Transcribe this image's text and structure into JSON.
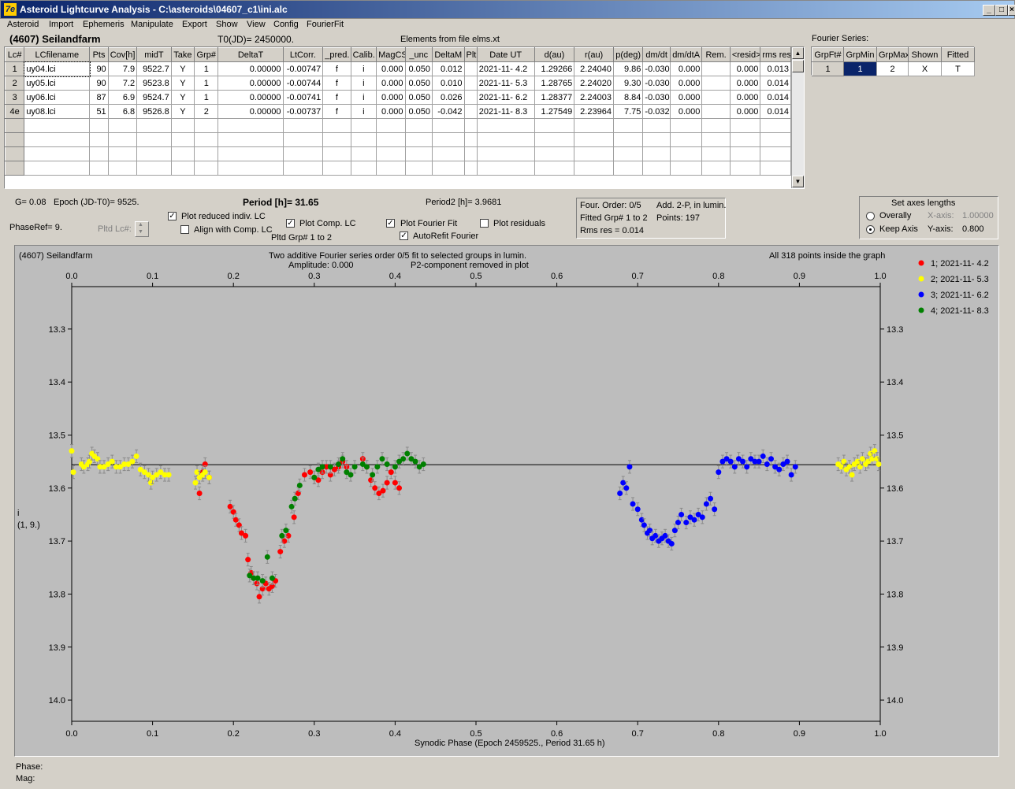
{
  "window": {
    "title": "Asteroid Lightcurve Analysis - C:\\asteroids\\04607_c1\\ini.alc",
    "icon_label": "7e",
    "btn_min": "_",
    "btn_max": "□",
    "btn_close": "×"
  },
  "menu": [
    "Asteroid",
    "Import",
    "Ephemeris",
    "Manipulate",
    "Export",
    "Show",
    "View",
    "Config",
    "FourierFit"
  ],
  "header": {
    "object": "(4607) Seilandfarm",
    "t0": "T0(JD)= 2450000.",
    "elements": "Elements from file elms.xt"
  },
  "lc_table": {
    "columns": [
      "Lc#",
      "LCfilename",
      "Pts",
      "Cov[h]",
      "midT",
      "Take",
      "Grp#",
      "DeltaT",
      "LtCorr.",
      "_pred.",
      "Calib.",
      "MagCS",
      "_unc",
      "DeltaM",
      "Plt",
      "Date UT",
      "d(au)",
      "r(au)",
      "p(deg)",
      "dm/dt",
      "dm/dtA",
      "Rem.",
      "<resid>",
      "rms res"
    ],
    "rows": [
      [
        "1",
        "uy04.lci",
        "90",
        "7.9",
        "9522.7",
        "Y",
        "1",
        "0.00000",
        "-0.00747",
        "f",
        "i",
        "0.000",
        "0.050",
        "0.012",
        "",
        "2021-11- 4.2",
        "1.29266",
        "2.24040",
        "9.86",
        "-0.030",
        "0.000",
        "",
        "0.000",
        "0.013"
      ],
      [
        "2",
        "uy05.lci",
        "90",
        "7.2",
        "9523.8",
        "Y",
        "1",
        "0.00000",
        "-0.00744",
        "f",
        "i",
        "0.000",
        "0.050",
        "0.010",
        "",
        "2021-11- 5.3",
        "1.28765",
        "2.24020",
        "9.30",
        "-0.030",
        "0.000",
        "",
        "0.000",
        "0.014"
      ],
      [
        "3",
        "uy06.lci",
        "87",
        "6.9",
        "9524.7",
        "Y",
        "1",
        "0.00000",
        "-0.00741",
        "f",
        "i",
        "0.000",
        "0.050",
        "0.026",
        "",
        "2021-11- 6.2",
        "1.28377",
        "2.24003",
        "8.84",
        "-0.030",
        "0.000",
        "",
        "0.000",
        "0.014"
      ],
      [
        "4e",
        "uy08.lci",
        "51",
        "6.8",
        "9526.8",
        "Y",
        "2",
        "0.00000",
        "-0.00737",
        "f",
        "i",
        "0.000",
        "0.050",
        "-0.042",
        "",
        "2021-11- 8.3",
        "1.27549",
        "2.23964",
        "7.75",
        "-0.032",
        "0.000",
        "",
        "0.000",
        "0.014"
      ]
    ]
  },
  "fourier_series": {
    "label": "Fourier Series:",
    "columns": [
      "GrpFt#",
      "GrpMin",
      "GrpMax",
      "Shown",
      "Fitted"
    ],
    "row": [
      "1",
      "1",
      "2",
      "X",
      "T"
    ]
  },
  "info": {
    "g": "G= 0.08",
    "epoch": "Epoch (JD-T0)= 9525.",
    "period": "Period [h]= 31.65",
    "period2": "Period2 [h]= 3.9681",
    "phaseref": "PhaseRef= 9.",
    "pltd_lc": "Pltd Lc#:",
    "plot_reduced": "Plot reduced indiv. LC",
    "align_comp": "Align with Comp. LC",
    "plot_comp": "Plot Comp. LC",
    "pltd_grp": "Pltd Grp#  1   to   2",
    "plot_fourier": "Plot Fourier Fit",
    "autorefit": "AutoRefit Fourier",
    "plot_residuals": "Plot residuals",
    "checks": {
      "plot_reduced": "✓",
      "align_comp": "",
      "plot_comp": "✓",
      "plot_fourier": "✓",
      "autorefit": "✓",
      "plot_residuals": ""
    }
  },
  "fit_summary": {
    "order": "Four. Order:  0/5",
    "add": "Add. 2-P, in lumin.",
    "fitted": "Fitted Grp# 1 to 2",
    "points": "Points: 197",
    "rms": "Rms res      = 0.014"
  },
  "axes_lengths": {
    "title": "Set axes lengths",
    "overally": "Overally",
    "keep": "Keep Axis",
    "xaxis_label": "X-axis:",
    "xaxis_val": "1.00000",
    "yaxis_label": "Y-axis:",
    "yaxis_val": "0.800"
  },
  "plot_texts": {
    "object": "(4607) Seilandfarm",
    "subtitle1": "Two additive Fourier series order 0/5 fit to selected groups in lumin.",
    "amplitude": "Amplitude: 0.000",
    "p2": "P2-component removed in plot",
    "points": "All 318 points inside the graph",
    "ylabel1": "i",
    "ylabel2": "(1, 9.)",
    "xlabel": "Synodic Phase (Epoch 2459525., Period 31.65 h)"
  },
  "status": {
    "phase": "Phase:",
    "mag": "Mag:"
  },
  "chart_data": {
    "type": "scatter",
    "xlim": [
      0.0,
      1.0
    ],
    "ylim": [
      13.22,
      14.04
    ],
    "y_inverted": true,
    "x_ticks": [
      "0.0",
      "0.1",
      "0.2",
      "0.3",
      "0.4",
      "0.5",
      "0.6",
      "0.7",
      "0.8",
      "0.9",
      "1.0"
    ],
    "y_ticks": [
      "13.3",
      "13.4",
      "13.5",
      "13.6",
      "13.7",
      "13.8",
      "13.9",
      "14.0"
    ],
    "fit_line_y": 13.556,
    "error_bar": 0.012,
    "series": [
      {
        "name": "1; 2021-11- 4.2",
        "color": "#ff0000",
        "points": [
          [
            0.158,
            13.61
          ],
          [
            0.162,
            13.57
          ],
          [
            0.165,
            13.555
          ],
          [
            0.17,
            13.58
          ],
          [
            0.196,
            13.635
          ],
          [
            0.2,
            13.645
          ],
          [
            0.203,
            13.66
          ],
          [
            0.207,
            13.67
          ],
          [
            0.21,
            13.685
          ],
          [
            0.215,
            13.69
          ],
          [
            0.218,
            13.735
          ],
          [
            0.222,
            13.76
          ],
          [
            0.225,
            13.77
          ],
          [
            0.229,
            13.78
          ],
          [
            0.232,
            13.805
          ],
          [
            0.236,
            13.79
          ],
          [
            0.24,
            13.78
          ],
          [
            0.244,
            13.79
          ],
          [
            0.248,
            13.785
          ],
          [
            0.252,
            13.775
          ],
          [
            0.258,
            13.72
          ],
          [
            0.263,
            13.7
          ],
          [
            0.268,
            13.69
          ],
          [
            0.275,
            13.655
          ],
          [
            0.28,
            13.61
          ],
          [
            0.288,
            13.575
          ],
          [
            0.295,
            13.57
          ],
          [
            0.3,
            13.58
          ],
          [
            0.305,
            13.585
          ],
          [
            0.31,
            13.57
          ],
          [
            0.315,
            13.56
          ],
          [
            0.32,
            13.575
          ],
          [
            0.325,
            13.565
          ],
          [
            0.33,
            13.56
          ],
          [
            0.335,
            13.55
          ],
          [
            0.34,
            13.56
          ],
          [
            0.36,
            13.545
          ],
          [
            0.365,
            13.56
          ],
          [
            0.37,
            13.585
          ],
          [
            0.375,
            13.6
          ],
          [
            0.38,
            13.61
          ],
          [
            0.385,
            13.605
          ],
          [
            0.39,
            13.59
          ],
          [
            0.395,
            13.57
          ],
          [
            0.4,
            13.59
          ],
          [
            0.405,
            13.6
          ]
        ]
      },
      {
        "name": "2; 2021-11- 5.3",
        "color": "#ffff00",
        "points": [
          [
            0.0,
            13.53
          ],
          [
            0.002,
            13.57
          ],
          [
            0.012,
            13.555
          ],
          [
            0.015,
            13.56
          ],
          [
            0.02,
            13.555
          ],
          [
            0.022,
            13.55
          ],
          [
            0.025,
            13.535
          ],
          [
            0.028,
            13.54
          ],
          [
            0.032,
            13.545
          ],
          [
            0.035,
            13.56
          ],
          [
            0.04,
            13.56
          ],
          [
            0.045,
            13.555
          ],
          [
            0.05,
            13.55
          ],
          [
            0.055,
            13.56
          ],
          [
            0.06,
            13.56
          ],
          [
            0.065,
            13.555
          ],
          [
            0.07,
            13.555
          ],
          [
            0.075,
            13.55
          ],
          [
            0.08,
            13.54
          ],
          [
            0.085,
            13.565
          ],
          [
            0.09,
            13.57
          ],
          [
            0.095,
            13.575
          ],
          [
            0.098,
            13.59
          ],
          [
            0.1,
            13.58
          ],
          [
            0.105,
            13.575
          ],
          [
            0.11,
            13.57
          ],
          [
            0.115,
            13.575
          ],
          [
            0.12,
            13.575
          ],
          [
            0.153,
            13.59
          ],
          [
            0.155,
            13.57
          ],
          [
            0.158,
            13.58
          ],
          [
            0.162,
            13.575
          ],
          [
            0.165,
            13.57
          ],
          [
            0.17,
            13.58
          ],
          [
            0.948,
            13.555
          ],
          [
            0.952,
            13.56
          ],
          [
            0.955,
            13.55
          ],
          [
            0.958,
            13.565
          ],
          [
            0.962,
            13.56
          ],
          [
            0.965,
            13.575
          ],
          [
            0.968,
            13.555
          ],
          [
            0.972,
            13.55
          ],
          [
            0.975,
            13.56
          ],
          [
            0.978,
            13.545
          ],
          [
            0.982,
            13.555
          ],
          [
            0.985,
            13.55
          ],
          [
            0.988,
            13.535
          ],
          [
            0.99,
            13.545
          ],
          [
            0.993,
            13.53
          ],
          [
            0.996,
            13.545
          ],
          [
            0.998,
            13.555
          ]
        ]
      },
      {
        "name": "3; 2021-11- 6.2",
        "color": "#0000ff",
        "points": [
          [
            0.678,
            13.61
          ],
          [
            0.682,
            13.59
          ],
          [
            0.686,
            13.6
          ],
          [
            0.69,
            13.56
          ],
          [
            0.694,
            13.63
          ],
          [
            0.7,
            13.64
          ],
          [
            0.705,
            13.66
          ],
          [
            0.708,
            13.67
          ],
          [
            0.712,
            13.685
          ],
          [
            0.715,
            13.68
          ],
          [
            0.718,
            13.695
          ],
          [
            0.722,
            13.69
          ],
          [
            0.726,
            13.7
          ],
          [
            0.73,
            13.695
          ],
          [
            0.734,
            13.69
          ],
          [
            0.738,
            13.7
          ],
          [
            0.742,
            13.705
          ],
          [
            0.746,
            13.68
          ],
          [
            0.75,
            13.665
          ],
          [
            0.754,
            13.65
          ],
          [
            0.76,
            13.665
          ],
          [
            0.765,
            13.655
          ],
          [
            0.77,
            13.66
          ],
          [
            0.775,
            13.65
          ],
          [
            0.78,
            13.655
          ],
          [
            0.785,
            13.63
          ],
          [
            0.79,
            13.62
          ],
          [
            0.795,
            13.64
          ],
          [
            0.8,
            13.57
          ],
          [
            0.805,
            13.55
          ],
          [
            0.81,
            13.545
          ],
          [
            0.815,
            13.55
          ],
          [
            0.82,
            13.56
          ],
          [
            0.825,
            13.545
          ],
          [
            0.83,
            13.55
          ],
          [
            0.835,
            13.56
          ],
          [
            0.84,
            13.545
          ],
          [
            0.845,
            13.55
          ],
          [
            0.85,
            13.55
          ],
          [
            0.855,
            13.54
          ],
          [
            0.86,
            13.555
          ],
          [
            0.865,
            13.545
          ],
          [
            0.87,
            13.56
          ],
          [
            0.875,
            13.565
          ],
          [
            0.88,
            13.555
          ],
          [
            0.885,
            13.55
          ],
          [
            0.89,
            13.575
          ],
          [
            0.895,
            13.56
          ]
        ]
      },
      {
        "name": "4; 2021-11- 8.3",
        "color": "#008000",
        "points": [
          [
            0.22,
            13.765
          ],
          [
            0.225,
            13.77
          ],
          [
            0.23,
            13.77
          ],
          [
            0.236,
            13.775
          ],
          [
            0.242,
            13.73
          ],
          [
            0.248,
            13.77
          ],
          [
            0.26,
            13.69
          ],
          [
            0.265,
            13.68
          ],
          [
            0.272,
            13.635
          ],
          [
            0.276,
            13.62
          ],
          [
            0.282,
            13.595
          ],
          [
            0.3,
            13.58
          ],
          [
            0.305,
            13.565
          ],
          [
            0.31,
            13.56
          ],
          [
            0.32,
            13.56
          ],
          [
            0.33,
            13.555
          ],
          [
            0.335,
            13.545
          ],
          [
            0.34,
            13.57
          ],
          [
            0.345,
            13.575
          ],
          [
            0.35,
            13.56
          ],
          [
            0.36,
            13.555
          ],
          [
            0.365,
            13.56
          ],
          [
            0.372,
            13.575
          ],
          [
            0.378,
            13.56
          ],
          [
            0.384,
            13.545
          ],
          [
            0.39,
            13.555
          ],
          [
            0.4,
            13.56
          ],
          [
            0.405,
            13.55
          ],
          [
            0.41,
            13.545
          ],
          [
            0.415,
            13.535
          ],
          [
            0.42,
            13.545
          ],
          [
            0.425,
            13.55
          ],
          [
            0.43,
            13.56
          ],
          [
            0.435,
            13.555
          ]
        ]
      }
    ]
  }
}
